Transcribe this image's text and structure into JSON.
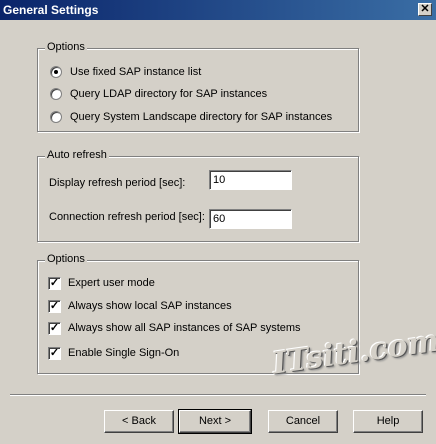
{
  "window": {
    "title": "General Settings",
    "close_glyph": "✕"
  },
  "options_group": {
    "legend": "Options",
    "radios": [
      {
        "label": "Use fixed SAP instance list",
        "selected": true
      },
      {
        "label": "Query LDAP directory for SAP instances",
        "selected": false
      },
      {
        "label": "Query System Landscape directory for SAP instances",
        "selected": false
      }
    ]
  },
  "auto_refresh": {
    "legend": "Auto refresh",
    "display_label": "Display refresh period [sec]:",
    "display_value": "10",
    "connection_label": "Connection refresh period [sec]:",
    "connection_value": "60"
  },
  "options_group2": {
    "legend": "Options",
    "checks": [
      {
        "label": "Expert user mode",
        "checked": true
      },
      {
        "label": "Always show local SAP instances",
        "checked": true
      },
      {
        "label": "Always show all SAP instances of SAP systems",
        "checked": true
      },
      {
        "label": "Enable Single Sign-On",
        "checked": true
      }
    ],
    "check_glyph": "✓"
  },
  "buttons": {
    "back": "< Back",
    "next": "Next >",
    "cancel": "Cancel",
    "help": "Help"
  },
  "watermark": "ITsiti.com"
}
